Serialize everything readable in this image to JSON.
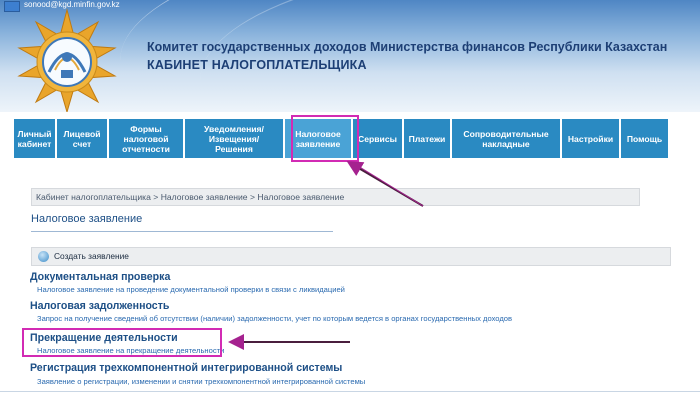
{
  "header": {
    "email": "sonood@kgd.minfin.gov.kz",
    "org_title": "Комитет государственных доходов Министерства финансов Республики Казахстан",
    "cabinet_title": "КАБИНЕТ НАЛОГОПЛАТЕЛЬЩИКА"
  },
  "nav": [
    {
      "line1": "Личный",
      "line2": "кабинет"
    },
    {
      "line1": "Лицевой",
      "line2": "счет"
    },
    {
      "line1": "Формы",
      "line2": "налоговой",
      "line3": "отчетности"
    },
    {
      "line1": "Уведомления/",
      "line2": "Извещения/",
      "line3": "Решения"
    },
    {
      "line1": "Налоговое",
      "line2": "заявление"
    },
    {
      "line1": "Сервисы"
    },
    {
      "line1": "Платежи"
    },
    {
      "line1": "Сопроводительные",
      "line2": "накладные"
    },
    {
      "line1": "Настройки"
    },
    {
      "line1": "Помощь"
    }
  ],
  "breadcrumb": "Кабинет налогоплательщика > Налоговое заявление > Налоговое заявление",
  "page_title": "Налоговое заявление",
  "create_label": "Создать заявление",
  "sections": [
    {
      "title": "Документальная проверка",
      "desc": "Налоговое заявление на проведение документальной проверки в связи с ликвидацией"
    },
    {
      "title": "Налоговая задолженность",
      "desc": "Запрос на получение сведений об отсутствии (наличии) задолженности, учет по которым ведется в органах государственных доходов"
    },
    {
      "title": "Прекращение деятельности",
      "desc": "Налоговое заявление на прекращение деятельности"
    },
    {
      "title": "Регистрация трехкомпонентной интегрированной системы",
      "desc": "Заявление о регистрации, изменении и снятии трехкомпонентной интегрированной системы"
    }
  ],
  "colors": {
    "nav": "#2a8ac2",
    "nav_active": "#4aa3d6",
    "highlight": "#d22bb4",
    "title": "#1d4f86",
    "link": "#2a6ab0"
  },
  "icons": [
    "email-icon",
    "emblem-logo-icon",
    "create-circle-icon",
    "arrow-annotation-icon"
  ]
}
